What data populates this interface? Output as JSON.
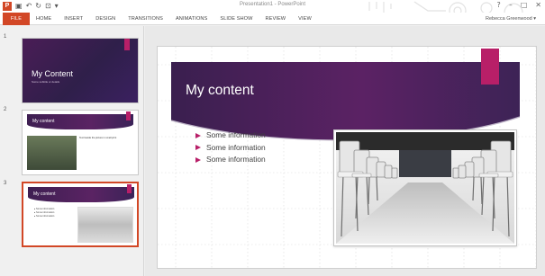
{
  "window": {
    "title": "Presentation1 - PowerPoint",
    "user": "Rebecca Greenwood",
    "app_logo": "P",
    "qat_icons": [
      "save-icon",
      "undo-icon",
      "redo-icon",
      "start-from-beginning-icon",
      "customize-qat-icon"
    ],
    "window_controls": [
      "help-icon",
      "minimize-icon",
      "maximize-icon",
      "close-icon"
    ]
  },
  "ribbon": {
    "tabs": [
      "FILE",
      "HOME",
      "INSERT",
      "DESIGN",
      "TRANSITIONS",
      "ANIMATIONS",
      "SLIDE SHOW",
      "REVIEW",
      "VIEW"
    ]
  },
  "thumbnails": [
    {
      "number": "1",
      "title": "My Content",
      "subtitle": "Some subtitle or details"
    },
    {
      "number": "2",
      "title": "My content",
      "body": "Text beside the picture in small print"
    },
    {
      "number": "3",
      "title": "My content",
      "bullets": [
        "Some information",
        "Some information",
        "Some information"
      ],
      "selected": true
    }
  ],
  "slide": {
    "title": "My content",
    "bullets": [
      "Some information",
      "Some information",
      "Some information"
    ],
    "image_description": "rows-of-white-chairs"
  },
  "colors": {
    "accent": "#b81f68",
    "banner": "#4a1d56",
    "file_tab": "#d24726"
  }
}
